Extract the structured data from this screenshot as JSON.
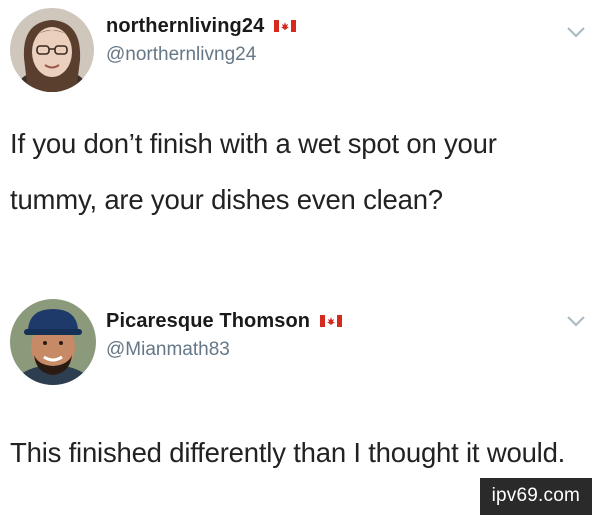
{
  "tweets": [
    {
      "display_name": "northernliving24",
      "handle": "@northernlivng24",
      "flag_icon": "canada-flag-icon",
      "text": "If you don’t finish with a wet spot on your tummy, are your dishes even clean?"
    },
    {
      "display_name": "Picaresque Thomson",
      "handle": "@Mianmath83",
      "flag_icon": "canada-flag-icon",
      "text": "This finished differently than I thought it would."
    }
  ],
  "watermark": "ipv69.com",
  "colors": {
    "flag_red": "#d52b1e",
    "handle_gray": "#657786",
    "chevron_gray": "#aab8c2"
  }
}
